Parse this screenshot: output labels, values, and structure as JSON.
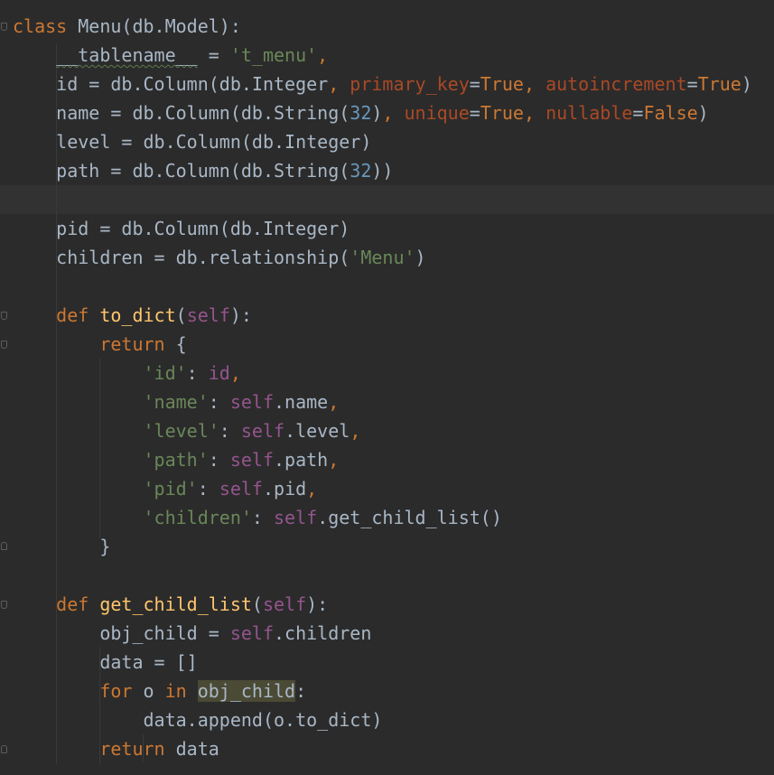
{
  "editor": {
    "language": "python",
    "colors": {
      "background": "#2b2b2b",
      "current_line": "#323232",
      "keyword": "#cc7832",
      "string": "#6a8759",
      "number": "#6897bb",
      "function": "#ffc66d",
      "self": "#94558d",
      "plain": "#a9b7c6",
      "highlight": "#4a4a35"
    },
    "lines": [
      {
        "t": [
          [
            "kw",
            "class"
          ],
          [
            "pl",
            " Menu(db.Model):"
          ]
        ]
      },
      {
        "t": [
          [
            "pl",
            "    "
          ],
          [
            "sq",
            "__tablename__"
          ],
          [
            "pl",
            " = "
          ],
          [
            "str",
            "'t_menu'"
          ],
          [
            "kw",
            ","
          ]
        ]
      },
      {
        "t": [
          [
            "pl",
            "    id = db.Column(db.Integer"
          ],
          [
            "kw",
            ", "
          ],
          [
            "param",
            "primary_key"
          ],
          [
            "pl",
            "="
          ],
          [
            "kw",
            "True"
          ],
          [
            "kw",
            ", "
          ],
          [
            "param",
            "autoincrement"
          ],
          [
            "pl",
            "="
          ],
          [
            "kw",
            "True"
          ],
          [
            "pl",
            ")"
          ]
        ]
      },
      {
        "t": [
          [
            "pl",
            "    name = db.Column(db.String("
          ],
          [
            "num",
            "32"
          ],
          [
            "pl",
            ")"
          ],
          [
            "kw",
            ", "
          ],
          [
            "param",
            "unique"
          ],
          [
            "pl",
            "="
          ],
          [
            "kw",
            "True"
          ],
          [
            "kw",
            ", "
          ],
          [
            "param",
            "nullable"
          ],
          [
            "pl",
            "="
          ],
          [
            "kw",
            "False"
          ],
          [
            "pl",
            ")"
          ]
        ]
      },
      {
        "t": [
          [
            "pl",
            "    level = db.Column(db.Integer)"
          ]
        ]
      },
      {
        "t": [
          [
            "pl",
            "    path = db.Column(db.String("
          ],
          [
            "num",
            "32"
          ],
          [
            "pl",
            "))"
          ]
        ]
      },
      {
        "t": [
          [
            "pl",
            ""
          ]
        ]
      },
      {
        "t": [
          [
            "pl",
            "    pid = db.Column(db.Integer)"
          ]
        ]
      },
      {
        "t": [
          [
            "pl",
            "    children = db.relationship("
          ],
          [
            "str",
            "'Menu'"
          ],
          [
            "pl",
            ")"
          ]
        ]
      },
      {
        "t": [
          [
            "pl",
            ""
          ]
        ]
      },
      {
        "t": [
          [
            "pl",
            "    "
          ],
          [
            "kw",
            "def "
          ],
          [
            "fn",
            "to_dict"
          ],
          [
            "pl",
            "("
          ],
          [
            "self",
            "self"
          ],
          [
            "pl",
            "):"
          ]
        ]
      },
      {
        "t": [
          [
            "pl",
            "        "
          ],
          [
            "kw",
            "return"
          ],
          [
            "pl",
            " {"
          ]
        ]
      },
      {
        "t": [
          [
            "pl",
            "            "
          ],
          [
            "str",
            "'id'"
          ],
          [
            "pl",
            ": "
          ],
          [
            "num2",
            "id"
          ],
          [
            "kw",
            ","
          ]
        ]
      },
      {
        "t": [
          [
            "pl",
            "            "
          ],
          [
            "str",
            "'name'"
          ],
          [
            "pl",
            ": "
          ],
          [
            "self",
            "self"
          ],
          [
            "pl",
            ".name"
          ],
          [
            "kw",
            ","
          ]
        ]
      },
      {
        "t": [
          [
            "pl",
            "            "
          ],
          [
            "str",
            "'level'"
          ],
          [
            "pl",
            ": "
          ],
          [
            "self",
            "self"
          ],
          [
            "pl",
            ".level"
          ],
          [
            "kw",
            ","
          ]
        ]
      },
      {
        "t": [
          [
            "pl",
            "            "
          ],
          [
            "str",
            "'path'"
          ],
          [
            "pl",
            ": "
          ],
          [
            "self",
            "self"
          ],
          [
            "pl",
            ".path"
          ],
          [
            "kw",
            ","
          ]
        ]
      },
      {
        "t": [
          [
            "pl",
            "            "
          ],
          [
            "str",
            "'pid'"
          ],
          [
            "pl",
            ": "
          ],
          [
            "self",
            "self"
          ],
          [
            "pl",
            ".pid"
          ],
          [
            "kw",
            ","
          ]
        ]
      },
      {
        "t": [
          [
            "pl",
            "            "
          ],
          [
            "str",
            "'children'"
          ],
          [
            "pl",
            ": "
          ],
          [
            "self",
            "self"
          ],
          [
            "pl",
            ".get_child_list()"
          ]
        ]
      },
      {
        "t": [
          [
            "pl",
            "        }"
          ]
        ]
      },
      {
        "t": [
          [
            "pl",
            ""
          ]
        ]
      },
      {
        "t": [
          [
            "pl",
            "    "
          ],
          [
            "kw",
            "def "
          ],
          [
            "fn",
            "get_child_list"
          ],
          [
            "pl",
            "("
          ],
          [
            "self",
            "self"
          ],
          [
            "pl",
            "):"
          ]
        ]
      },
      {
        "t": [
          [
            "pl",
            "        obj_child = "
          ],
          [
            "self",
            "self"
          ],
          [
            "pl",
            ".children"
          ]
        ]
      },
      {
        "t": [
          [
            "pl",
            "        data = []"
          ]
        ]
      },
      {
        "t": [
          [
            "pl",
            "        "
          ],
          [
            "kw",
            "for"
          ],
          [
            "pl",
            " o "
          ],
          [
            "kw",
            "in"
          ],
          [
            "pl",
            " "
          ],
          [
            "hl",
            "obj_child"
          ],
          [
            "pl",
            ":"
          ]
        ]
      },
      {
        "t": [
          [
            "pl",
            "            data.append(o.to_dict)"
          ]
        ]
      },
      {
        "t": [
          [
            "pl",
            "        "
          ],
          [
            "kw",
            "return"
          ],
          [
            "pl",
            " data"
          ]
        ]
      }
    ]
  }
}
